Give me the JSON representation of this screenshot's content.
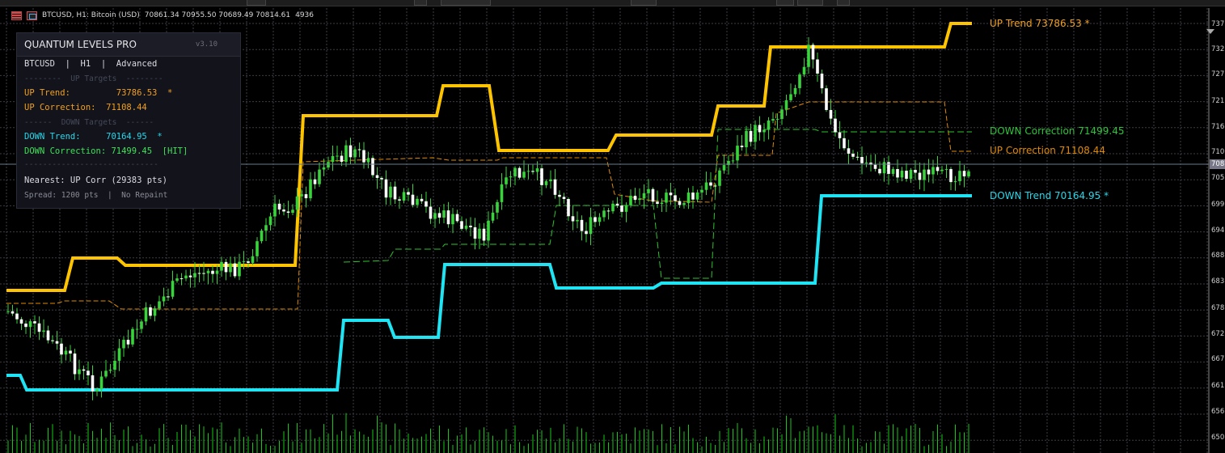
{
  "header": {
    "symbol_line": "BTCUSD, H1:  Bitcoin (USD)",
    "ohlc": "70861.34 70955.50 70689.49 70814.61",
    "volume": "4936"
  },
  "panel": {
    "title": "QUANTUM LEVELS PRO",
    "version": "v3.10",
    "context": "BTCUSD  |  H1  |  Advanced",
    "up_section": "--------  UP Targets  --------",
    "up_trend": "UP Trend:         73786.53  *",
    "up_correction": "UP Correction:  71108.44",
    "down_section": "------  DOWN Targets  ------",
    "down_trend": "DOWN Trend:     70164.95  *",
    "down_correction": "DOWN Correction: 71499.45  [HIT]",
    "separator": "-----------------------------",
    "nearest": "Nearest: UP Corr (29383 pts)",
    "footer": "Spread: 1200 pts  |  No Repaint"
  },
  "labels": {
    "up_trend": "UP Trend 73786.53 *",
    "down_correction": "DOWN Correction 71499.45",
    "up_correction": "UP Correction 71108.44",
    "down_trend": "DOWN Trend 70164.95 *"
  },
  "price_axis": {
    "ticks": [
      "737",
      "732",
      "727",
      "721",
      "716",
      "710",
      "705",
      "699",
      "694",
      "688",
      "683",
      "678",
      "672",
      "667",
      "661",
      "656",
      "650"
    ],
    "current": "708"
  },
  "colors": {
    "background": "#000000",
    "grid": "#3c3c46",
    "candle_up": "#39d43c",
    "candle_down": "#ffffff",
    "up_trend": "#ffc400",
    "up_correction": "#e08a00",
    "down_trend": "#1fe4f4",
    "down_correction": "#2bc42b",
    "volume": "#14c814"
  }
}
